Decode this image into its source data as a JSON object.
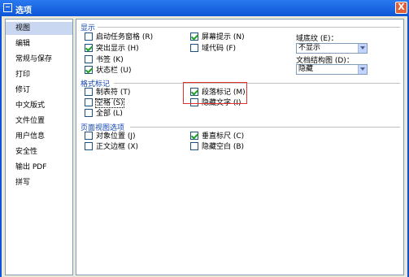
{
  "window": {
    "title": "选项",
    "close_label": "X"
  },
  "sidebar": {
    "items": [
      {
        "label": "视图",
        "selected": true
      },
      {
        "label": "编辑"
      },
      {
        "label": "常规与保存"
      },
      {
        "label": "打印"
      },
      {
        "label": "修订"
      },
      {
        "label": "中文版式"
      },
      {
        "label": "文件位置"
      },
      {
        "label": "用户信息"
      },
      {
        "label": "安全性"
      },
      {
        "label": "输出 PDF"
      },
      {
        "label": "拼写"
      }
    ]
  },
  "display": {
    "title": "显示",
    "options": [
      {
        "label": "启动任务窗格 (R)",
        "checked": false
      },
      {
        "label": "突出显示 (H)",
        "checked": true
      },
      {
        "label": "书签 (K)",
        "checked": false
      },
      {
        "label": "状态栏 (U)",
        "checked": true
      },
      {
        "label": "屏幕提示 (N)",
        "checked": true
      },
      {
        "label": "域代码 (F)",
        "checked": false
      }
    ],
    "field_shading_label": "域底纹 (E)：",
    "field_shading_value": "不显示",
    "doc_map_label": "文档结构图 (D)：",
    "doc_map_value": "隐藏"
  },
  "formatting": {
    "title": "格式标记",
    "options": [
      {
        "label": "制表符 (T)",
        "checked": false
      },
      {
        "label": "空格 (S)",
        "checked": false
      },
      {
        "label": "全部 (L)",
        "checked": false
      },
      {
        "label": "段落标记 (M)",
        "checked": true
      },
      {
        "label": "隐藏文字 (I)",
        "checked": false
      }
    ]
  },
  "page_view": {
    "title": "页面视图选项",
    "options": [
      {
        "label": "对象位置 (J)",
        "checked": false
      },
      {
        "label": "正文边框 (X)",
        "checked": false
      },
      {
        "label": "垂直标尺 (C)",
        "checked": true
      },
      {
        "label": "隐藏空白 (B)",
        "checked": false
      }
    ]
  },
  "colors": {
    "accent": "#1246b0",
    "titlebar": "#0a53d8",
    "highlight": "#e53030",
    "check": "#21a121"
  }
}
